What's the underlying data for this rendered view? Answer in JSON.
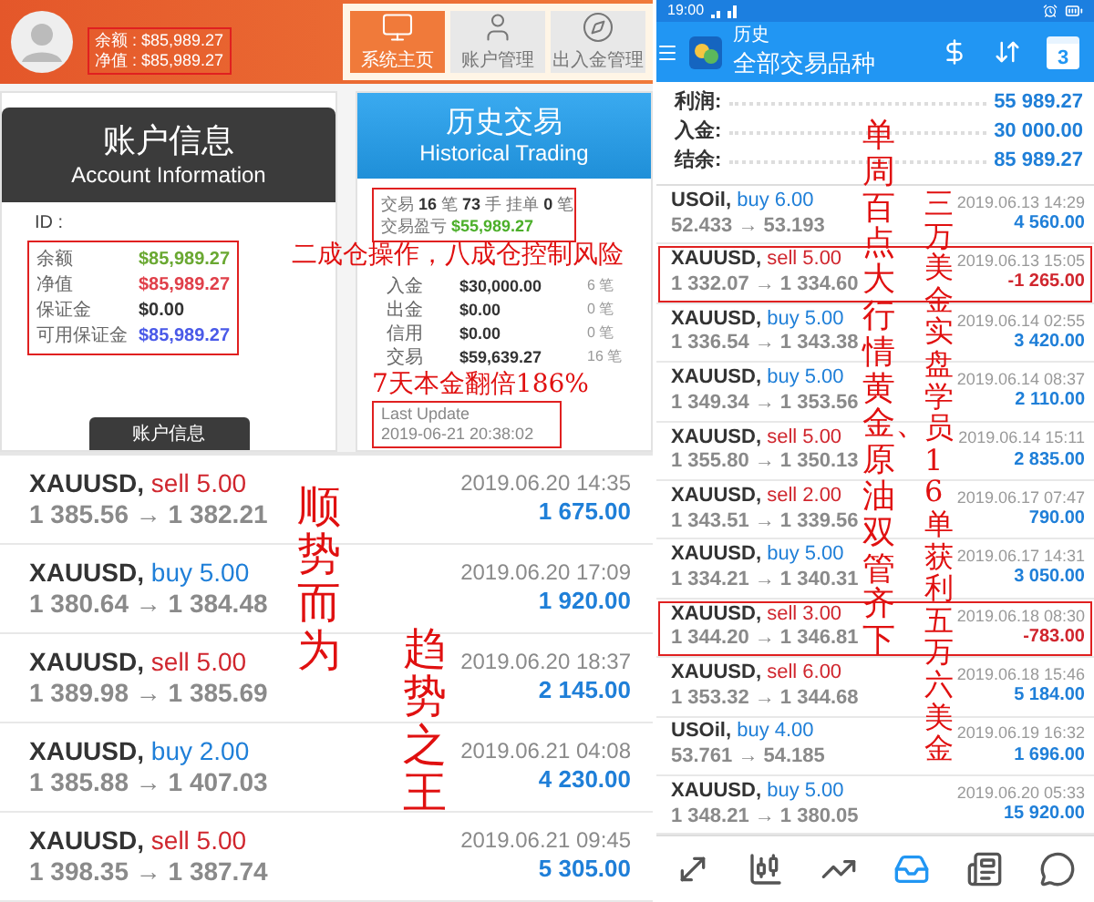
{
  "account_header": {
    "balances": [
      "余额 : $85,989.27",
      "净值 : $85,989.27"
    ],
    "nav": [
      {
        "label": "系统主页",
        "selected": true
      },
      {
        "label": "账户管理",
        "selected": false
      },
      {
        "label": "出入金管理",
        "selected": false
      }
    ]
  },
  "account_info": {
    "title": "账户信息",
    "subtitle": "Account Information",
    "id_label": "ID :",
    "rows": [
      {
        "label": "余额",
        "value": "$85,989.27",
        "color": "#6aa832"
      },
      {
        "label": "净值",
        "value": "$85,989.27",
        "color": "#e0404a"
      },
      {
        "label": "保证金",
        "value": "$0.00",
        "color": "#333333"
      },
      {
        "label": "可用保证金",
        "value": "$85,989.27",
        "color": "#4a5ae8"
      }
    ],
    "button": "账户信息"
  },
  "history_panel": {
    "title": "历史交易",
    "subtitle": "Historical Trading",
    "stats_line": "交易 **16** 笔   **73** 手   挂单 **0** 笔",
    "profit": {
      "label": "交易盈亏",
      "value": "$55,989.27"
    },
    "rows": [
      {
        "label": "入金",
        "amount": "$30,000.00",
        "count": "6 笔"
      },
      {
        "label": "出金",
        "amount": "$0.00",
        "count": "0 笔"
      },
      {
        "label": "信用",
        "amount": "$0.00",
        "count": "0 笔"
      },
      {
        "label": "交易",
        "amount": "$59,639.27",
        "count": "16 笔"
      }
    ],
    "last_update": {
      "label": "Last Update",
      "value": "2019-06-21 20:38:02"
    }
  },
  "left_annotations": [
    {
      "kind": "horizontal",
      "text": "二成仓操作，八成仓控制风险"
    },
    {
      "kind": "inline",
      "text": "7天本金翻倍186%"
    },
    {
      "kind": "vertical",
      "text": "顺势而为"
    },
    {
      "kind": "vertical",
      "text": "趋势之王"
    }
  ],
  "recent_trades": [
    {
      "symbol": "XAUUSD,",
      "kind": "sell",
      "order": "sell 5.00",
      "prices": "1 385.56 → 1 382.21",
      "time": "2019.06.20 14:35",
      "profit": "1 675.00"
    },
    {
      "symbol": "XAUUSD,",
      "kind": "buy",
      "order": "buy 5.00",
      "prices": "1 380.64 → 1 384.48",
      "time": "2019.06.20 17:09",
      "profit": "1 920.00"
    },
    {
      "symbol": "XAUUSD,",
      "kind": "sell",
      "order": "sell 5.00",
      "prices": "1 389.98 → 1 385.69",
      "time": "2019.06.20 18:37",
      "profit": "2 145.00"
    },
    {
      "symbol": "XAUUSD,",
      "kind": "buy",
      "order": "buy 2.00",
      "prices": "1 385.88 → 1 407.03",
      "time": "2019.06.21 04:08",
      "profit": "4 230.00"
    },
    {
      "symbol": "XAUUSD,",
      "kind": "sell",
      "order": "sell 5.00",
      "prices": "1 398.35 → 1 387.74",
      "time": "2019.06.21 09:45",
      "profit": "5 305.00"
    }
  ],
  "status_bar": {
    "time": "19:00"
  },
  "app_bar": {
    "title": "历史",
    "subtitle": "全部交易品种",
    "calendar_day": "3"
  },
  "summary": [
    {
      "label": "利润:",
      "value": "55 989.27"
    },
    {
      "label": "入金:",
      "value": "30 000.00"
    },
    {
      "label": "结余:",
      "value": "85 989.27"
    }
  ],
  "trades": [
    {
      "symbol": "USOil,",
      "kind": "buy",
      "order": "buy 6.00",
      "prices": "52.433 → 53.193",
      "time": "2019.06.13 14:29",
      "profit": "4 560.00",
      "loss": false,
      "highlighted": false
    },
    {
      "symbol": "XAUUSD,",
      "kind": "sell",
      "order": "sell 5.00",
      "prices": "1 332.07 → 1 334.60",
      "time": "2019.06.13 15:05",
      "profit": "-1 265.00",
      "loss": true,
      "highlighted": true
    },
    {
      "symbol": "XAUUSD,",
      "kind": "buy",
      "order": "buy 5.00",
      "prices": "1 336.54 → 1 343.38",
      "time": "2019.06.14 02:55",
      "profit": "3 420.00",
      "loss": false,
      "highlighted": false
    },
    {
      "symbol": "XAUUSD,",
      "kind": "buy",
      "order": "buy 5.00",
      "prices": "1 349.34 → 1 353.56",
      "time": "2019.06.14 08:37",
      "profit": "2 110.00",
      "loss": false,
      "highlighted": false
    },
    {
      "symbol": "XAUUSD,",
      "kind": "sell",
      "order": "sell 5.00",
      "prices": "1 355.80 → 1 350.13",
      "time": "2019.06.14 15:11",
      "profit": "2 835.00",
      "loss": false,
      "highlighted": false
    },
    {
      "symbol": "XAUUSD,",
      "kind": "sell",
      "order": "sell 2.00",
      "prices": "1 343.51 → 1 339.56",
      "time": "2019.06.17 07:47",
      "profit": "790.00",
      "loss": false,
      "highlighted": false
    },
    {
      "symbol": "XAUUSD,",
      "kind": "buy",
      "order": "buy 5.00",
      "prices": "1 334.21 → 1 340.31",
      "time": "2019.06.17 14:31",
      "profit": "3 050.00",
      "loss": false,
      "highlighted": false
    },
    {
      "symbol": "XAUUSD,",
      "kind": "sell",
      "order": "sell 3.00",
      "prices": "1 344.20 → 1 346.81",
      "time": "2019.06.18 08:30",
      "profit": "-783.00",
      "loss": true,
      "highlighted": true
    },
    {
      "symbol": "XAUUSD,",
      "kind": "sell",
      "order": "sell 6.00",
      "prices": "1 353.32 → 1 344.68",
      "time": "2019.06.18 15:46",
      "profit": "5 184.00",
      "loss": false,
      "highlighted": false
    },
    {
      "symbol": "USOil,",
      "kind": "buy",
      "order": "buy 4.00",
      "prices": "53.761 → 54.185",
      "time": "2019.06.19 16:32",
      "profit": "1 696.00",
      "loss": false,
      "highlighted": false
    },
    {
      "symbol": "XAUUSD,",
      "kind": "buy",
      "order": "buy 5.00",
      "prices": "1 348.21 → 1 380.05",
      "time": "2019.06.20 05:33",
      "profit": "15 920.00",
      "loss": false,
      "highlighted": false
    }
  ],
  "right_annotations": [
    {
      "kind": "vertical",
      "text": "单周百点大行情黄金、原油双管齐下"
    },
    {
      "kind": "vertical",
      "text": "三万美金实盘学员16单获利五万六美金"
    }
  ],
  "bottom_nav": [
    {
      "selected": false
    },
    {
      "selected": false
    },
    {
      "selected": false
    },
    {
      "selected": true
    },
    {
      "selected": false
    },
    {
      "selected": false
    }
  ]
}
